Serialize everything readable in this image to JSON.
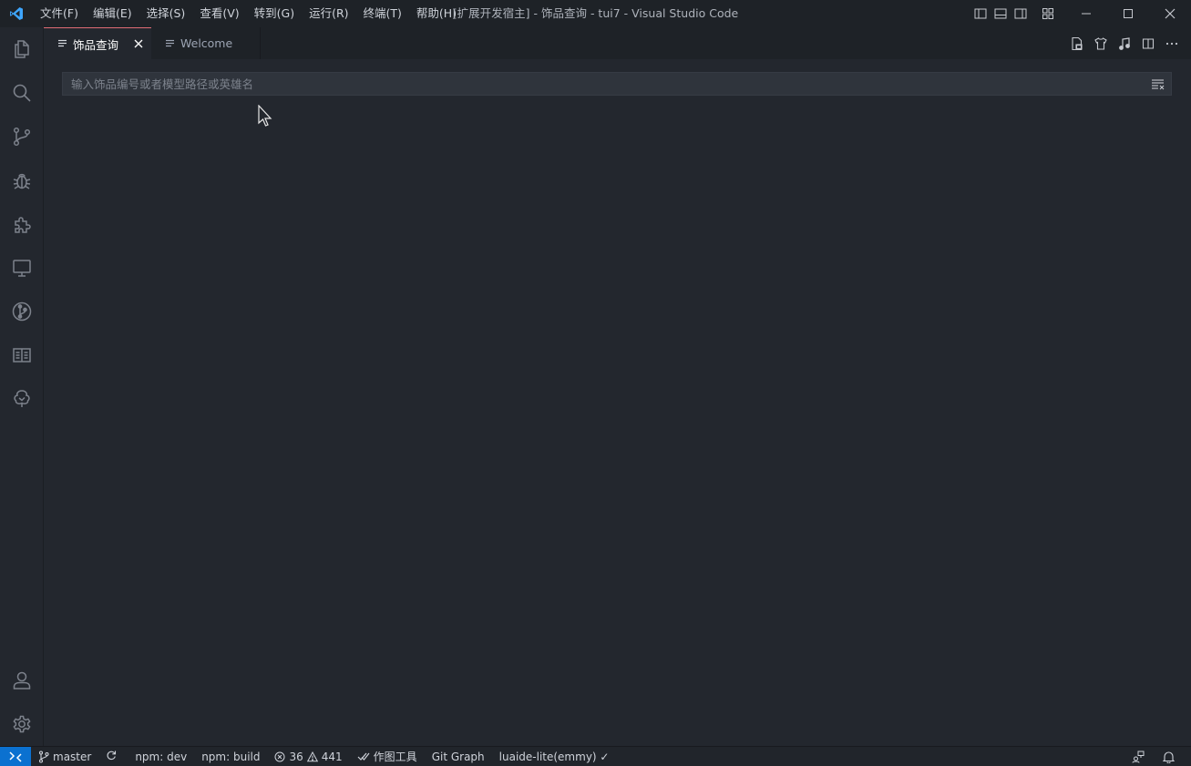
{
  "titlebar": {
    "menus": [
      "文件(F)",
      "编辑(E)",
      "选择(S)",
      "查看(V)",
      "转到(G)",
      "运行(R)",
      "终端(T)",
      "帮助(H)"
    ],
    "window_title": "[扩展开发宿主] - 饰品查询 - tui7 - Visual Studio Code"
  },
  "activitybar": {
    "icons": [
      "explorer-icon",
      "search-icon",
      "source-control-icon",
      "debug-icon",
      "extensions-icon",
      "remote-explorer-icon",
      "git-graph-icon",
      "book-icon",
      "tree-icon",
      "account-icon",
      "settings-gear-icon"
    ]
  },
  "tabs": [
    {
      "label": "饰品查询",
      "active": true
    },
    {
      "label": "Welcome",
      "active": false
    }
  ],
  "editor": {
    "search_placeholder": "输入饰品编号或者模型路径或英雄名",
    "search_value": ""
  },
  "statusbar": {
    "branch": "master",
    "task_dev": "npm: dev",
    "task_build": "npm: build",
    "errors": "36",
    "warnings": "441",
    "tool": "作图工具",
    "git_graph": "Git Graph",
    "lua": "luaide-lite(emmy) ✓"
  },
  "colors": {
    "accent_remote": "#0b71d0",
    "active_tab_border": "#e06c75",
    "vscode_logo": "#3ea6ff"
  }
}
